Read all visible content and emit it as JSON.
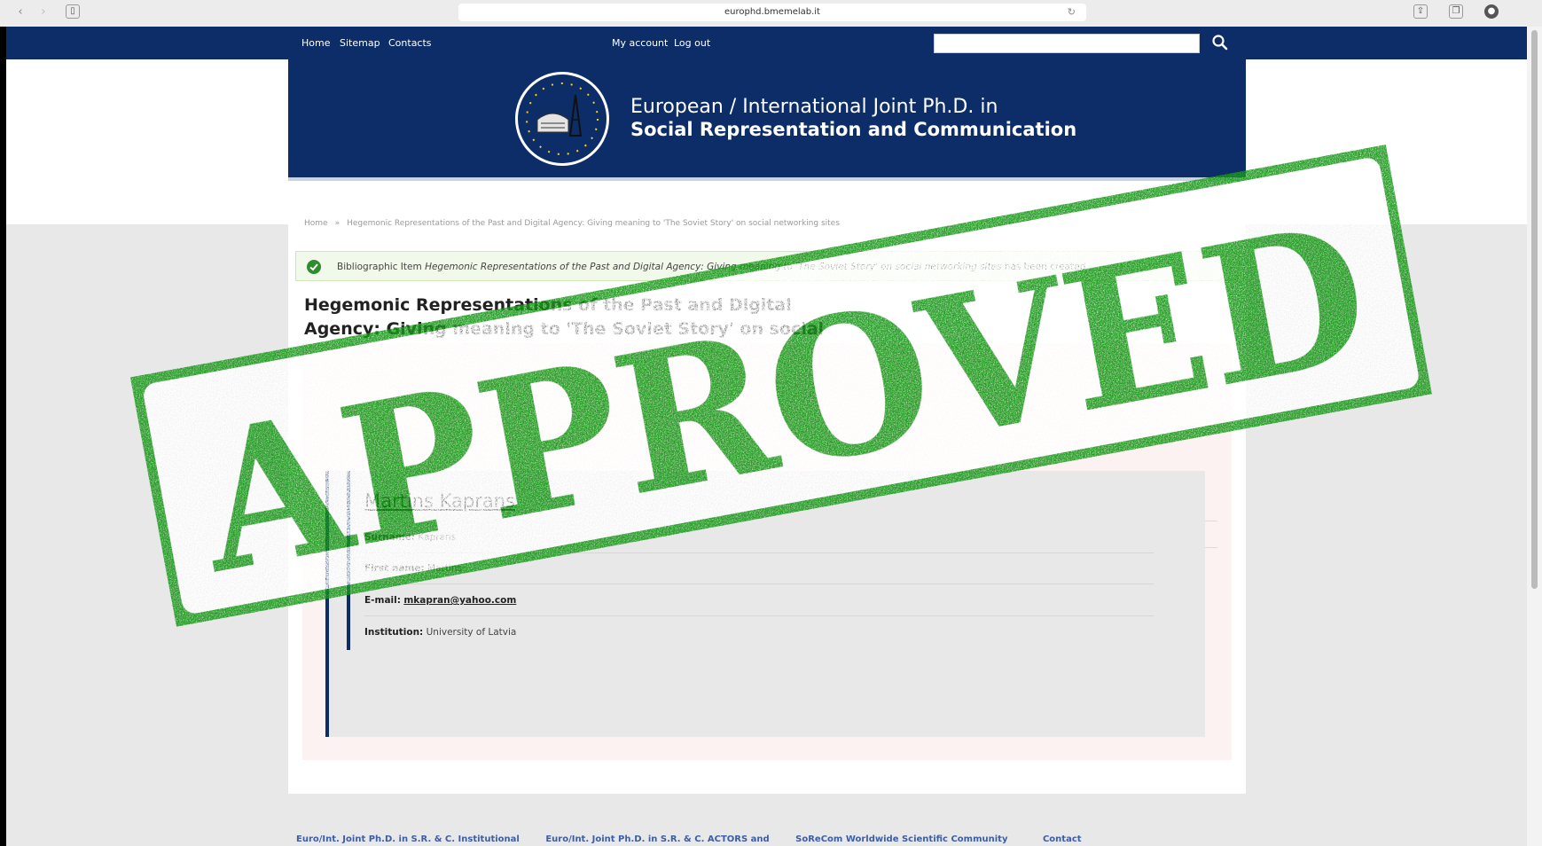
{
  "browser": {
    "url": "europhd.bmemelab.it"
  },
  "topbar": {
    "nav": [
      "Home",
      "Sitemap",
      "Contacts"
    ],
    "account": [
      "My account",
      "Log out"
    ],
    "search_placeholder": ""
  },
  "banner": {
    "line1": "European / International Joint Ph.D. in",
    "line2": "Social Representation and Communication"
  },
  "breadcrumb": {
    "home": "Home",
    "current": "Hegemonic Representations of the Past and Digital Agency: Giving meaning to 'The Soviet Story' on social networking sites"
  },
  "message": {
    "prefix": "Bibliographic Item",
    "item": "Hegemonic Representations of the Past and Digital Agency: Giving meaning to 'The Soviet Story' on social networking sites",
    "suffix": "has been created"
  },
  "title": "Hegemonic Representations of the Past and Digital Agency: Giving meaning to 'The Soviet Story' on social networking sites",
  "author": {
    "name": "Martins Kaprans",
    "surname_label": "Surname:",
    "surname": "Kaprans",
    "first_name_label": "First name:",
    "first_name": "Martins",
    "email_label": "E-mail:",
    "email": "mkapran@yahoo.com",
    "institution_label": "Institution:",
    "institution": "University of Latvia"
  },
  "footer": {
    "links": [
      "Euro/Int. Joint Ph.D. in S.R. & C. Institutional",
      "Euro/Int. Joint Ph.D. in S.R. & C. ACTORS and",
      "SoReCom Worldwide Scientific Community",
      "Contact"
    ]
  },
  "stamp": {
    "text": "APPROVED",
    "color": "#1a9a1a"
  },
  "colors": {
    "navy": "#0c2d68",
    "success_bg": "#f1f9ea",
    "link": "#3b5ea8"
  }
}
